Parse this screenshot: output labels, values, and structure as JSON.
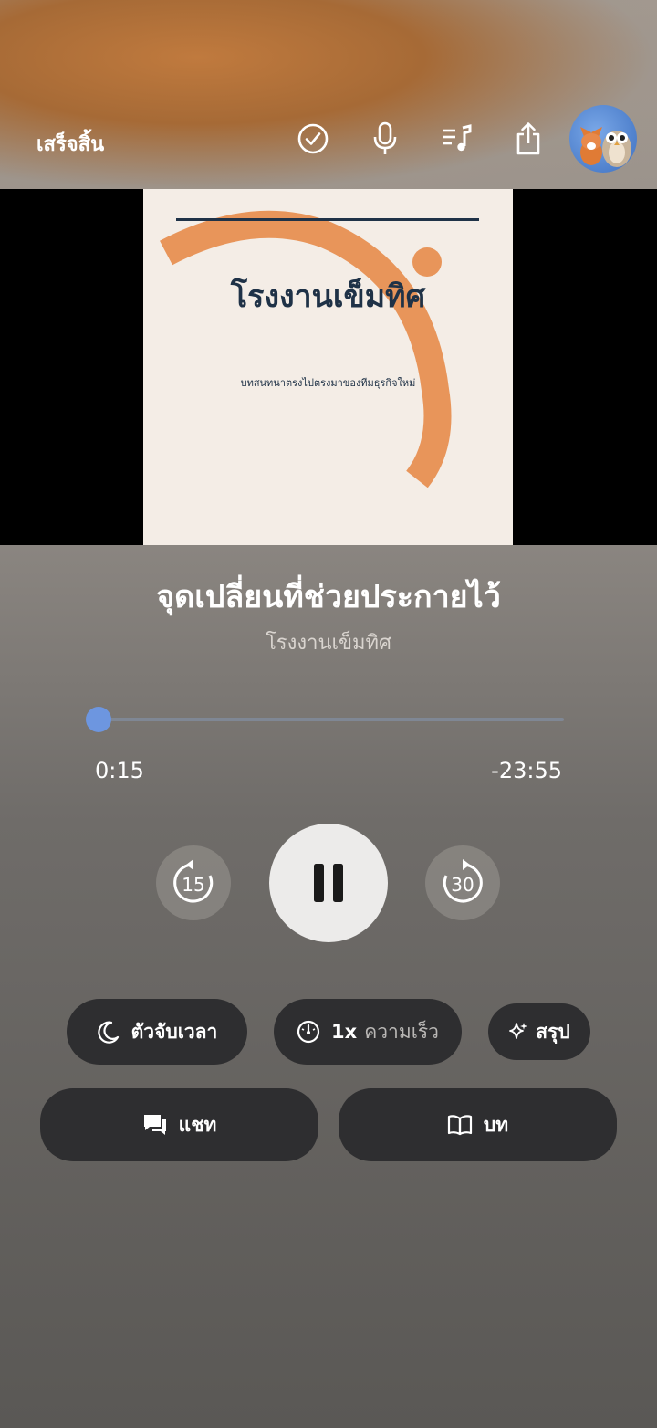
{
  "header": {
    "done_label": "เสร็จสิ้น",
    "icons": [
      "check-circle-icon",
      "microphone-icon",
      "playlist-icon",
      "share-icon",
      "avatar"
    ]
  },
  "artwork": {
    "title": "โรงงานเข็มทิศ",
    "subtitle": "บทสนทนาตรงไปตรงมาของทีมธุรกิจใหม่"
  },
  "episode": {
    "title": "จุดเปลี่ยนที่ช่วยประกายไว้",
    "show": "โรงงานเข็มทิศ"
  },
  "progress": {
    "fraction": 0.01,
    "elapsed": "0:15",
    "remaining": "-23:55"
  },
  "controls": {
    "back_seconds": "15",
    "forward_seconds": "30",
    "state": "playing"
  },
  "actions": {
    "timer_label": "ตัวจับเวลา",
    "speed_value": "1x",
    "speed_label": "ความเร็ว",
    "summary_label": "สรุป",
    "chat_label": "แชท",
    "transcript_label": "บท"
  },
  "colors": {
    "accent": "#6d96e0",
    "cover_bg": "#f4ede6",
    "cover_arc": "#e8955a",
    "cover_text": "#1f3247",
    "pill_bg": "#2e2e30"
  }
}
